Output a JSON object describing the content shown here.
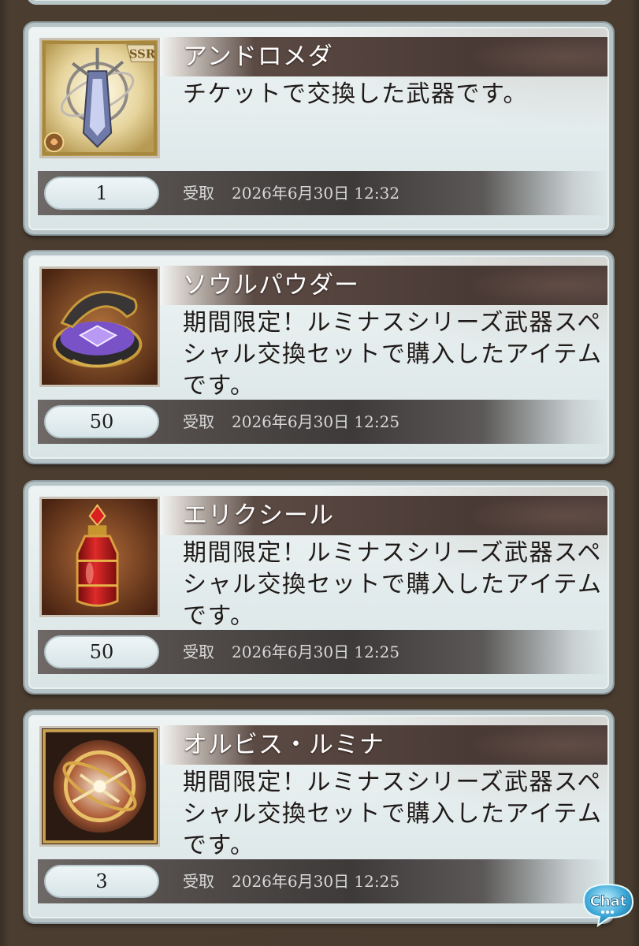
{
  "items": [
    {
      "name": "アンドロメダ",
      "description": "チケットで交換した武器です。",
      "quantity": "1",
      "received_label": "受取",
      "received_date": "2026年6月30日 12:32",
      "icon": "weapon-andromeda-icon",
      "badge": "SSR"
    },
    {
      "name": "ソウルパウダー",
      "description": "期間限定！ルミナスシリーズ武器スペシャル交換セットで購入したアイテムです。",
      "quantity": "50",
      "received_label": "受取",
      "received_date": "2026年6月30日 12:25",
      "icon": "soul-powder-icon"
    },
    {
      "name": "エリクシール",
      "description": "期間限定！ルミナスシリーズ武器スペシャル交換セットで購入したアイテムです。",
      "quantity": "50",
      "received_label": "受取",
      "received_date": "2026年6月30日 12:25",
      "icon": "elixir-icon"
    },
    {
      "name": "オルビス・ルミナ",
      "description": "期間限定！ルミナスシリーズ武器スペシャル交換セットで購入したアイテムです。",
      "quantity": "3",
      "received_label": "受取",
      "received_date": "2026年6月30日 12:25",
      "icon": "orbis-lumina-icon"
    }
  ],
  "chat_button": {
    "label": "Chat"
  }
}
